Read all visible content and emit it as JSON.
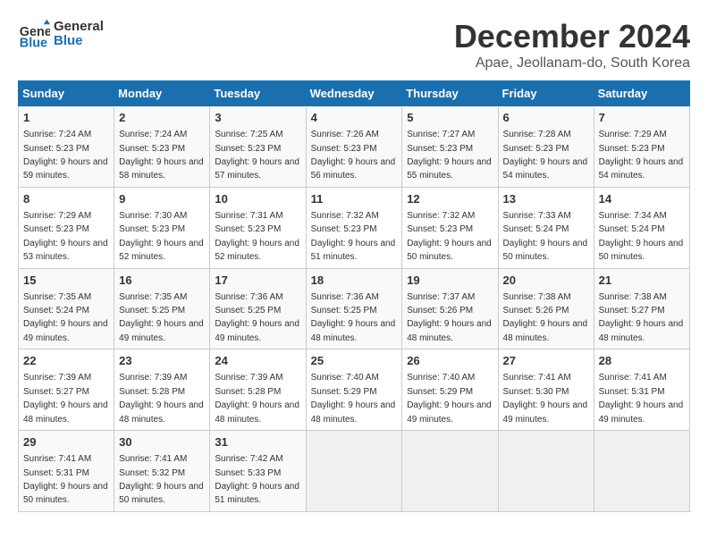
{
  "logo": {
    "line1": "General",
    "line2": "Blue"
  },
  "title": "December 2024",
  "subtitle": "Apae, Jeollanam-do, South Korea",
  "days_of_week": [
    "Sunday",
    "Monday",
    "Tuesday",
    "Wednesday",
    "Thursday",
    "Friday",
    "Saturday"
  ],
  "weeks": [
    [
      {
        "day": "1",
        "sunrise": "7:24 AM",
        "sunset": "5:23 PM",
        "daylight": "9 hours and 59 minutes."
      },
      {
        "day": "2",
        "sunrise": "7:24 AM",
        "sunset": "5:23 PM",
        "daylight": "9 hours and 58 minutes."
      },
      {
        "day": "3",
        "sunrise": "7:25 AM",
        "sunset": "5:23 PM",
        "daylight": "9 hours and 57 minutes."
      },
      {
        "day": "4",
        "sunrise": "7:26 AM",
        "sunset": "5:23 PM",
        "daylight": "9 hours and 56 minutes."
      },
      {
        "day": "5",
        "sunrise": "7:27 AM",
        "sunset": "5:23 PM",
        "daylight": "9 hours and 55 minutes."
      },
      {
        "day": "6",
        "sunrise": "7:28 AM",
        "sunset": "5:23 PM",
        "daylight": "9 hours and 54 minutes."
      },
      {
        "day": "7",
        "sunrise": "7:29 AM",
        "sunset": "5:23 PM",
        "daylight": "9 hours and 54 minutes."
      }
    ],
    [
      {
        "day": "8",
        "sunrise": "7:29 AM",
        "sunset": "5:23 PM",
        "daylight": "9 hours and 53 minutes."
      },
      {
        "day": "9",
        "sunrise": "7:30 AM",
        "sunset": "5:23 PM",
        "daylight": "9 hours and 52 minutes."
      },
      {
        "day": "10",
        "sunrise": "7:31 AM",
        "sunset": "5:23 PM",
        "daylight": "9 hours and 52 minutes."
      },
      {
        "day": "11",
        "sunrise": "7:32 AM",
        "sunset": "5:23 PM",
        "daylight": "9 hours and 51 minutes."
      },
      {
        "day": "12",
        "sunrise": "7:32 AM",
        "sunset": "5:23 PM",
        "daylight": "9 hours and 50 minutes."
      },
      {
        "day": "13",
        "sunrise": "7:33 AM",
        "sunset": "5:24 PM",
        "daylight": "9 hours and 50 minutes."
      },
      {
        "day": "14",
        "sunrise": "7:34 AM",
        "sunset": "5:24 PM",
        "daylight": "9 hours and 50 minutes."
      }
    ],
    [
      {
        "day": "15",
        "sunrise": "7:35 AM",
        "sunset": "5:24 PM",
        "daylight": "9 hours and 49 minutes."
      },
      {
        "day": "16",
        "sunrise": "7:35 AM",
        "sunset": "5:25 PM",
        "daylight": "9 hours and 49 minutes."
      },
      {
        "day": "17",
        "sunrise": "7:36 AM",
        "sunset": "5:25 PM",
        "daylight": "9 hours and 49 minutes."
      },
      {
        "day": "18",
        "sunrise": "7:36 AM",
        "sunset": "5:25 PM",
        "daylight": "9 hours and 48 minutes."
      },
      {
        "day": "19",
        "sunrise": "7:37 AM",
        "sunset": "5:26 PM",
        "daylight": "9 hours and 48 minutes."
      },
      {
        "day": "20",
        "sunrise": "7:38 AM",
        "sunset": "5:26 PM",
        "daylight": "9 hours and 48 minutes."
      },
      {
        "day": "21",
        "sunrise": "7:38 AM",
        "sunset": "5:27 PM",
        "daylight": "9 hours and 48 minutes."
      }
    ],
    [
      {
        "day": "22",
        "sunrise": "7:39 AM",
        "sunset": "5:27 PM",
        "daylight": "9 hours and 48 minutes."
      },
      {
        "day": "23",
        "sunrise": "7:39 AM",
        "sunset": "5:28 PM",
        "daylight": "9 hours and 48 minutes."
      },
      {
        "day": "24",
        "sunrise": "7:39 AM",
        "sunset": "5:28 PM",
        "daylight": "9 hours and 48 minutes."
      },
      {
        "day": "25",
        "sunrise": "7:40 AM",
        "sunset": "5:29 PM",
        "daylight": "9 hours and 48 minutes."
      },
      {
        "day": "26",
        "sunrise": "7:40 AM",
        "sunset": "5:29 PM",
        "daylight": "9 hours and 49 minutes."
      },
      {
        "day": "27",
        "sunrise": "7:41 AM",
        "sunset": "5:30 PM",
        "daylight": "9 hours and 49 minutes."
      },
      {
        "day": "28",
        "sunrise": "7:41 AM",
        "sunset": "5:31 PM",
        "daylight": "9 hours and 49 minutes."
      }
    ],
    [
      {
        "day": "29",
        "sunrise": "7:41 AM",
        "sunset": "5:31 PM",
        "daylight": "9 hours and 50 minutes."
      },
      {
        "day": "30",
        "sunrise": "7:41 AM",
        "sunset": "5:32 PM",
        "daylight": "9 hours and 50 minutes."
      },
      {
        "day": "31",
        "sunrise": "7:42 AM",
        "sunset": "5:33 PM",
        "daylight": "9 hours and 51 minutes."
      },
      null,
      null,
      null,
      null
    ]
  ]
}
